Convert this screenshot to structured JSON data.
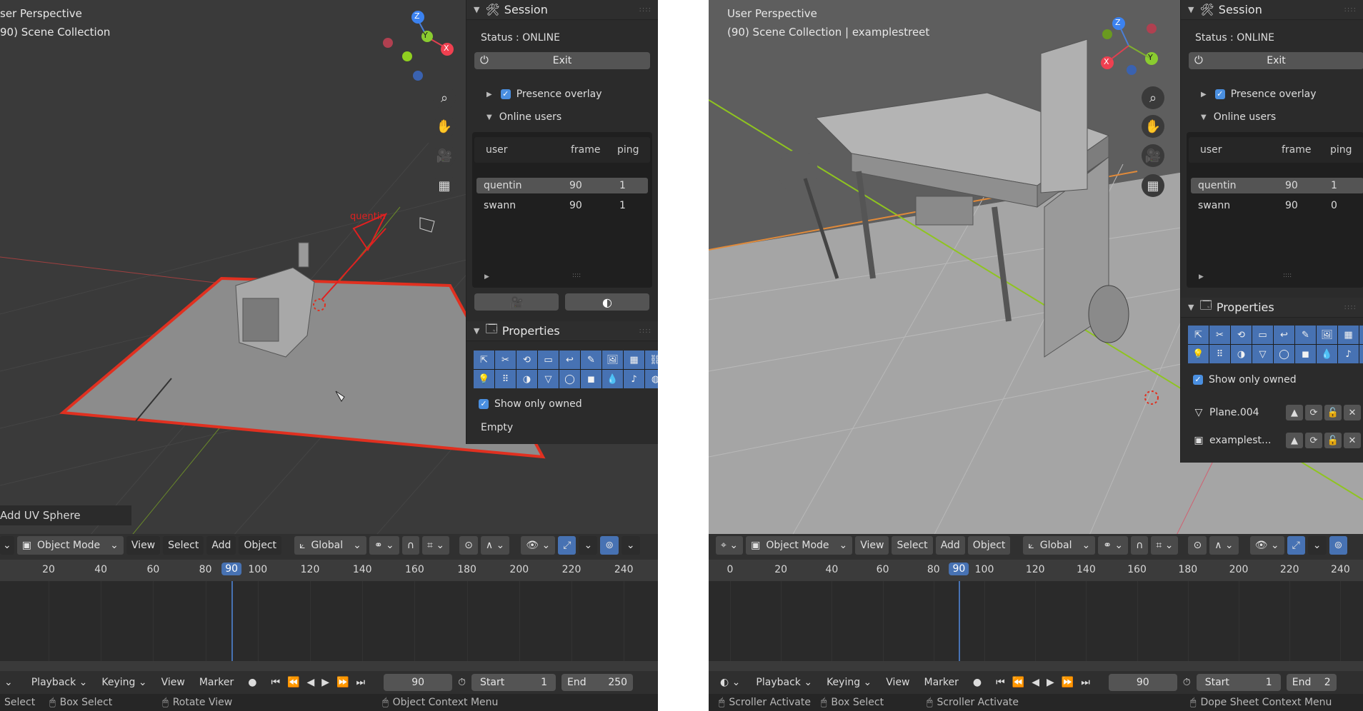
{
  "left": {
    "view_title": "ser Perspective",
    "collection": "90) Scene Collection",
    "gizmo": {
      "z": "Z",
      "y": "Y",
      "x": "X"
    },
    "object_label": "quentin",
    "session": {
      "title": "Session",
      "status": "Status : ONLINE",
      "exit_label": "Exit",
      "presence_label": "Presence overlay",
      "online_users_label": "Online users",
      "columns": [
        "user",
        "frame",
        "ping"
      ],
      "users": [
        {
          "user": "quentin",
          "frame": "90",
          "ping": "1"
        },
        {
          "user": "swann",
          "frame": "90",
          "ping": "1"
        }
      ]
    },
    "properties": {
      "title": "Properties",
      "show_owned": "Show only owned",
      "empty": "Empty"
    },
    "operator_panel": "Add UV Sphere",
    "toolbar": {
      "mode": "Object Mode",
      "menu": [
        "View",
        "Select",
        "Add",
        "Object"
      ],
      "transform": "Global"
    },
    "timeline": {
      "ticks": [
        "20",
        "40",
        "60",
        "80",
        "90",
        "100",
        "120",
        "140",
        "160",
        "180",
        "200",
        "220",
        "240"
      ],
      "current": "90"
    },
    "playback": {
      "menu": [
        "Playback",
        "Keying",
        "View",
        "Marker"
      ],
      "frame": "90",
      "start_label": "Start",
      "start": "1",
      "end_label": "End",
      "end": "250"
    },
    "status": [
      "Select",
      "Box Select",
      "Rotate View",
      "Object Context Menu"
    ]
  },
  "right": {
    "view_title": "User Perspective",
    "collection": "(90) Scene Collection | examplestreet",
    "gizmo": {
      "z": "Z",
      "y": "Y",
      "x": "X"
    },
    "session": {
      "title": "Session",
      "status": "Status : ONLINE",
      "exit_label": "Exit",
      "presence_label": "Presence overlay",
      "online_users_label": "Online users",
      "columns": [
        "user",
        "frame",
        "ping"
      ],
      "users": [
        {
          "user": "quentin",
          "frame": "90",
          "ping": "1"
        },
        {
          "user": "swann",
          "frame": "90",
          "ping": "0"
        }
      ]
    },
    "properties": {
      "title": "Properties",
      "show_owned": "Show only owned",
      "objects": [
        "Plane.004",
        "examplest..."
      ]
    },
    "toolbar": {
      "mode": "Object Mode",
      "menu": [
        "View",
        "Select",
        "Add",
        "Object"
      ],
      "transform": "Global"
    },
    "timeline": {
      "ticks": [
        "0",
        "20",
        "40",
        "60",
        "80",
        "90",
        "100",
        "120",
        "140",
        "160",
        "180",
        "200",
        "220",
        "240"
      ],
      "current": "90"
    },
    "playback": {
      "menu": [
        "Playback",
        "Keying",
        "View",
        "Marker"
      ],
      "frame": "90",
      "start_label": "Start",
      "start": "1",
      "end_label": "End",
      "end": "2"
    },
    "status": [
      "Scroller Activate",
      "Box Select",
      "Scroller Activate",
      "Dope Sheet Context Menu"
    ]
  },
  "icons": [
    "cursor",
    "tweak",
    "orbit",
    "folder",
    "curve",
    "pen",
    "image",
    "grid",
    "link",
    "bulb",
    "dots",
    "half-circle",
    "funnel",
    "circle",
    "square",
    "drops",
    "note",
    "globe"
  ],
  "colors": {
    "accent": "#4772b3",
    "panel": "#2b2b2b",
    "viewport": "#3d3d3d",
    "selection": "#e0301e"
  }
}
